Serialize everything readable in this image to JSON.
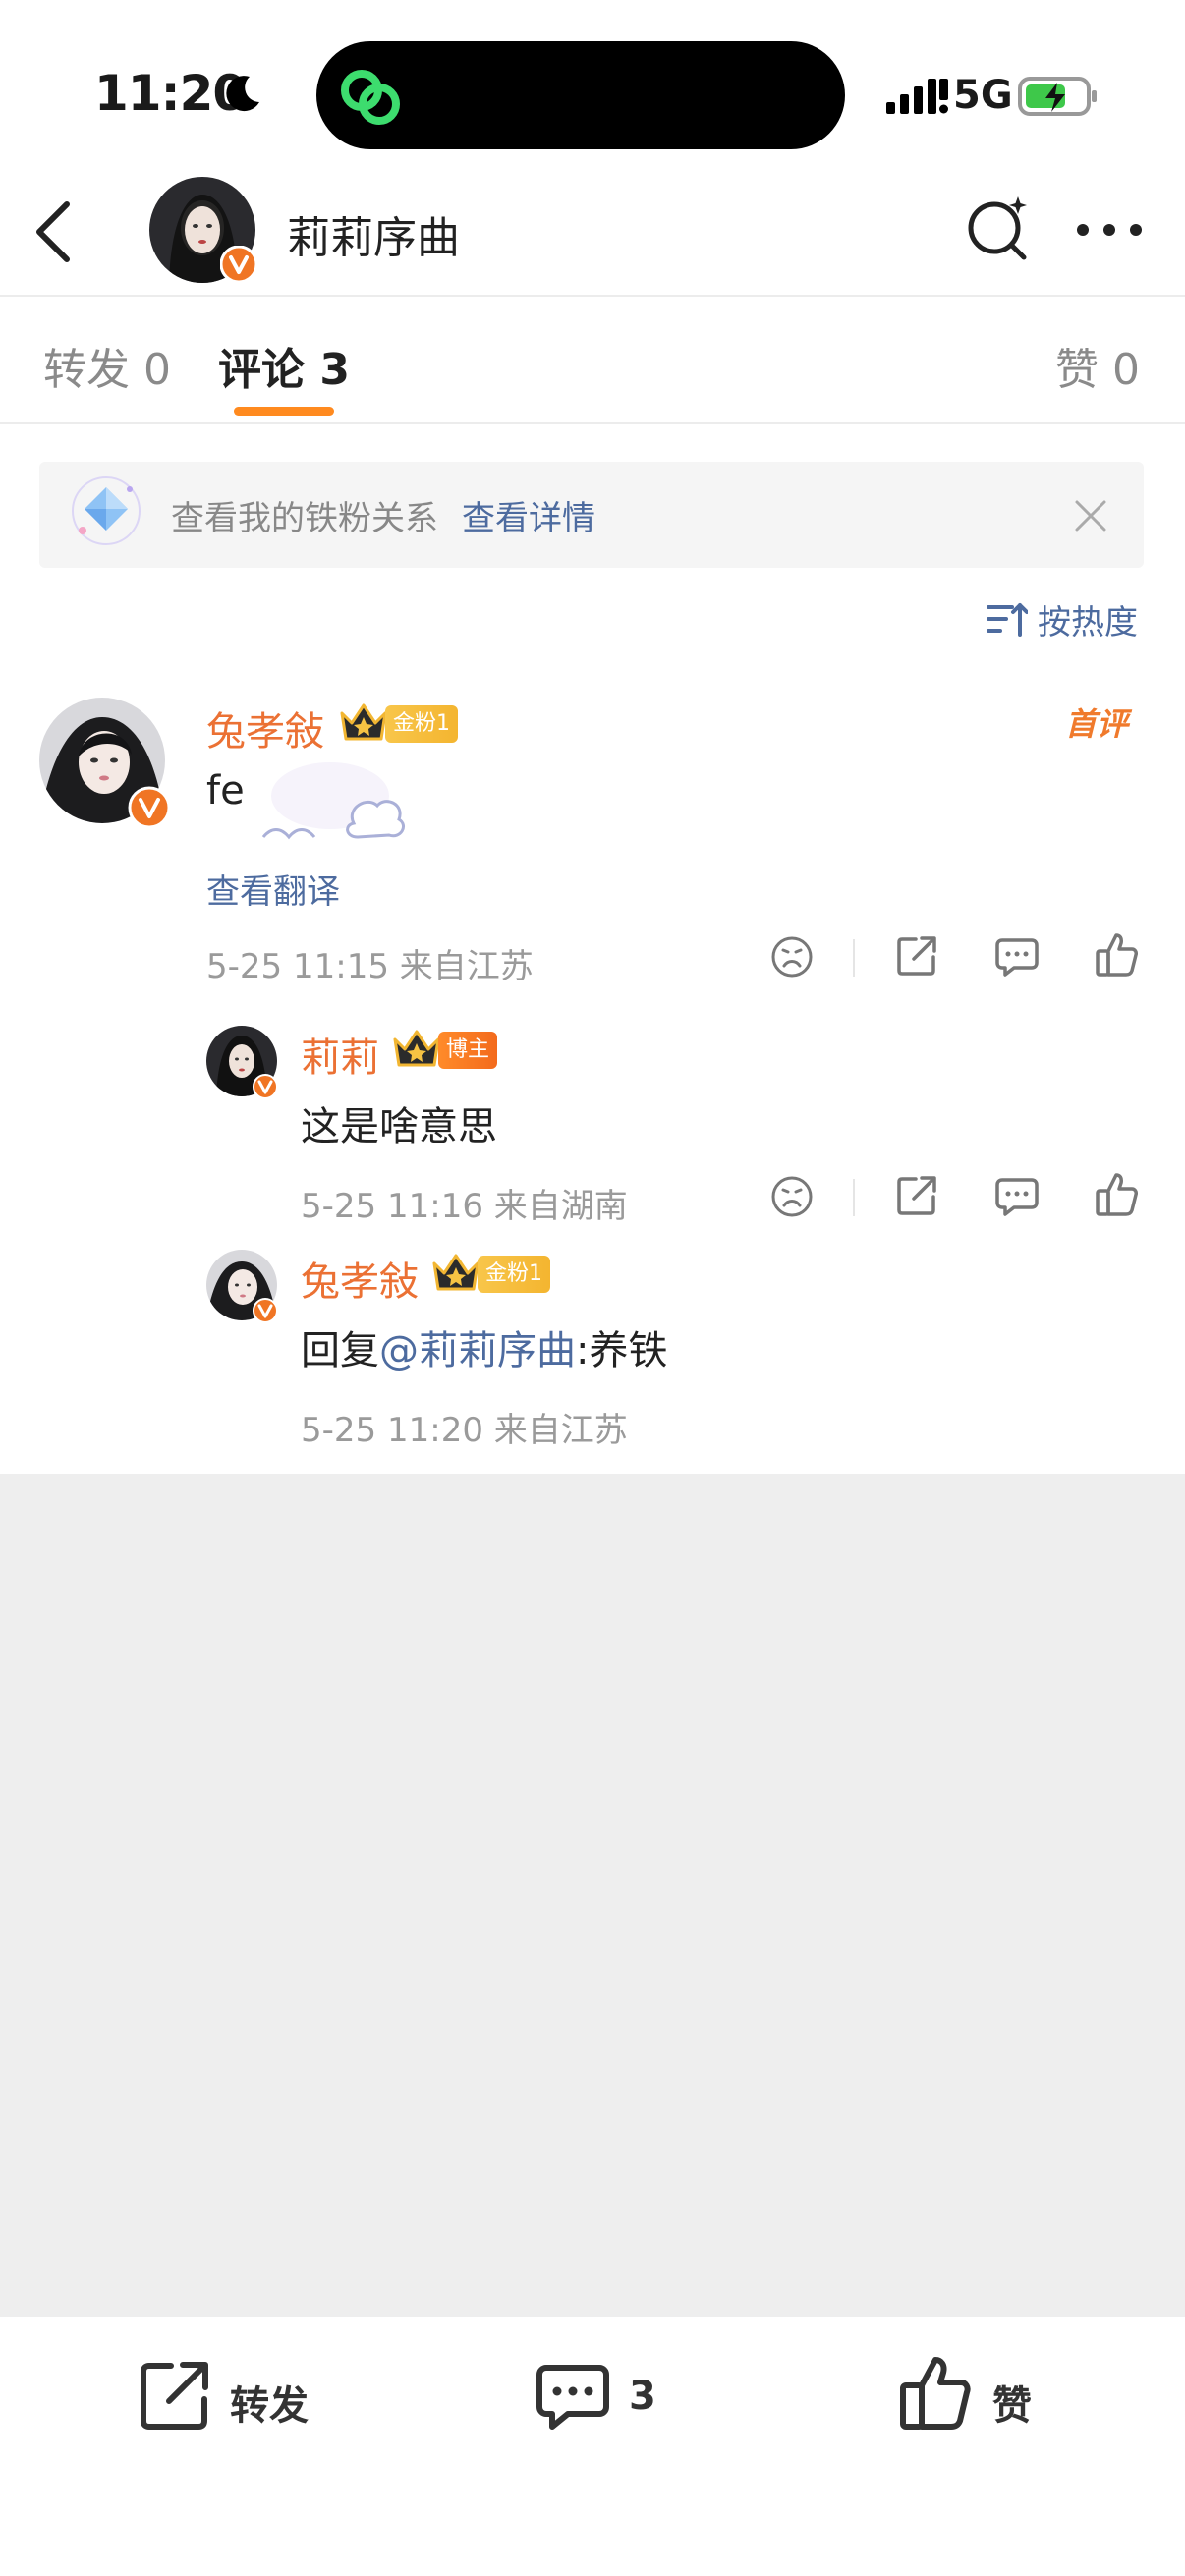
{
  "status_bar": {
    "time": "11:20",
    "network": "5G"
  },
  "header": {
    "account_name": "莉莉序曲"
  },
  "tabs": [
    {
      "label": "转发 0"
    },
    {
      "label": "评论 3"
    },
    {
      "label": "赞 0"
    }
  ],
  "banner": {
    "text": "查看我的铁粉关系",
    "link": "查看详情"
  },
  "sort": {
    "label": "按热度"
  },
  "comments": [
    {
      "user": "兔孝敍",
      "badge": "金粉1",
      "first_badge": "首评",
      "content": "fe",
      "translate": "查看翻译",
      "meta": "5-25 11:15  来自江苏"
    }
  ],
  "replies": [
    {
      "user": "莉莉",
      "badge": "博主",
      "content": "这是啥意思",
      "meta": "5-25 11:16  来自湖南"
    },
    {
      "user": "兔孝敍",
      "badge": "金粉1",
      "content_prefix": "回复",
      "mention": "@莉莉序曲",
      "content_suffix": ":养铁",
      "meta": "5-25 11:20  来自江苏"
    }
  ],
  "bottom_bar": {
    "repost": "转发",
    "comment_count": "3",
    "like": "赞"
  },
  "colors": {
    "accent": "#ff8a1f",
    "username": "#eb7134",
    "link": "#4d6b9f",
    "island_logo": "#3ddc6e"
  }
}
